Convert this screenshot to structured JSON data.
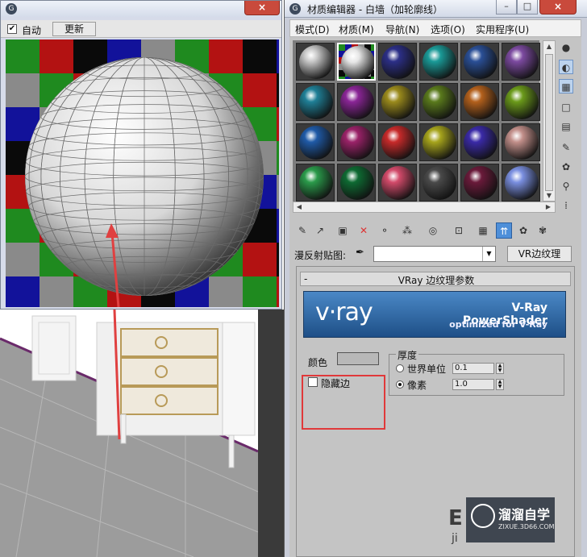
{
  "preview": {
    "auto_label": "自动",
    "auto_checked": true,
    "update_label": "更新",
    "close_glyph": "×"
  },
  "editor": {
    "title": "材质编辑器 - 白墙（加轮廓线）",
    "menu": [
      "模式(D)",
      "材质(M)",
      "导航(N)",
      "选项(O)",
      "实用程序(U)"
    ],
    "map_label": "漫反射贴图:",
    "map_type_button": "VR边纹理",
    "slot_colors": [
      [
        "#c9c9c9",
        "checker",
        "#2c2f87",
        "#1a9a97",
        "#2a4f96",
        "#7c4aa0"
      ],
      [
        "#1f7f96",
        "#8a2596",
        "#9a8a1c",
        "#5a7a1c",
        "#b3601c",
        "#6b9a1a"
      ],
      [
        "#1f5aa7",
        "#9a2268",
        "#c72a2a",
        "#a6a41c",
        "#3a2aa7",
        "#c28f8a"
      ],
      [
        "#2a9a4a",
        "#0e6a32",
        "#d24a6a",
        "#4a4a4a",
        "#6a1a3a",
        "#7a8fe0"
      ]
    ],
    "icons": {
      "side": [
        "sample-type-icon",
        "backlight-icon",
        "background-icon",
        "uv-tiling-icon",
        "video-color-check-icon",
        "make-preview-icon",
        "options-icon",
        "select-by-material-icon",
        "material-map-navigator-icon"
      ],
      "toolbar": [
        "get-material-icon",
        "put-to-scene-icon",
        "assign-to-selection-icon",
        "reset-map-icon",
        "make-unique-icon",
        "put-to-library-icon",
        "material-id-channel-icon",
        "show-map-icon",
        "show-end-result-icon",
        "go-to-parent-icon",
        "go-forward-to-sibling-icon"
      ]
    }
  },
  "rollout": {
    "minus": "-",
    "title": "VRay 边纹理参数",
    "banner_logo": "v·ray",
    "banner_title": "V-Ray PowerShader",
    "banner_sub": "optimized for V-Ray",
    "color_label": "颜色",
    "color_value": "#b8b8b8",
    "hide_edges_label": "隐藏边",
    "hide_edges_checked": false,
    "thickness_title": "厚度",
    "world_units_label": "世界单位",
    "world_units_value": "0.1",
    "pixels_label": "像素",
    "pixels_value": "1.0",
    "selected_unit": "pixels"
  },
  "watermark": {
    "title": "溜溜自学",
    "sub": "ZIXUE.3D66.COM",
    "partial_text": "E",
    "partial_text2": "ji"
  },
  "preview_sphere_colors": [
    "#1f8a1f",
    "#12129a",
    "#b31212",
    "#8a8a8a",
    "#0a0a0a"
  ]
}
